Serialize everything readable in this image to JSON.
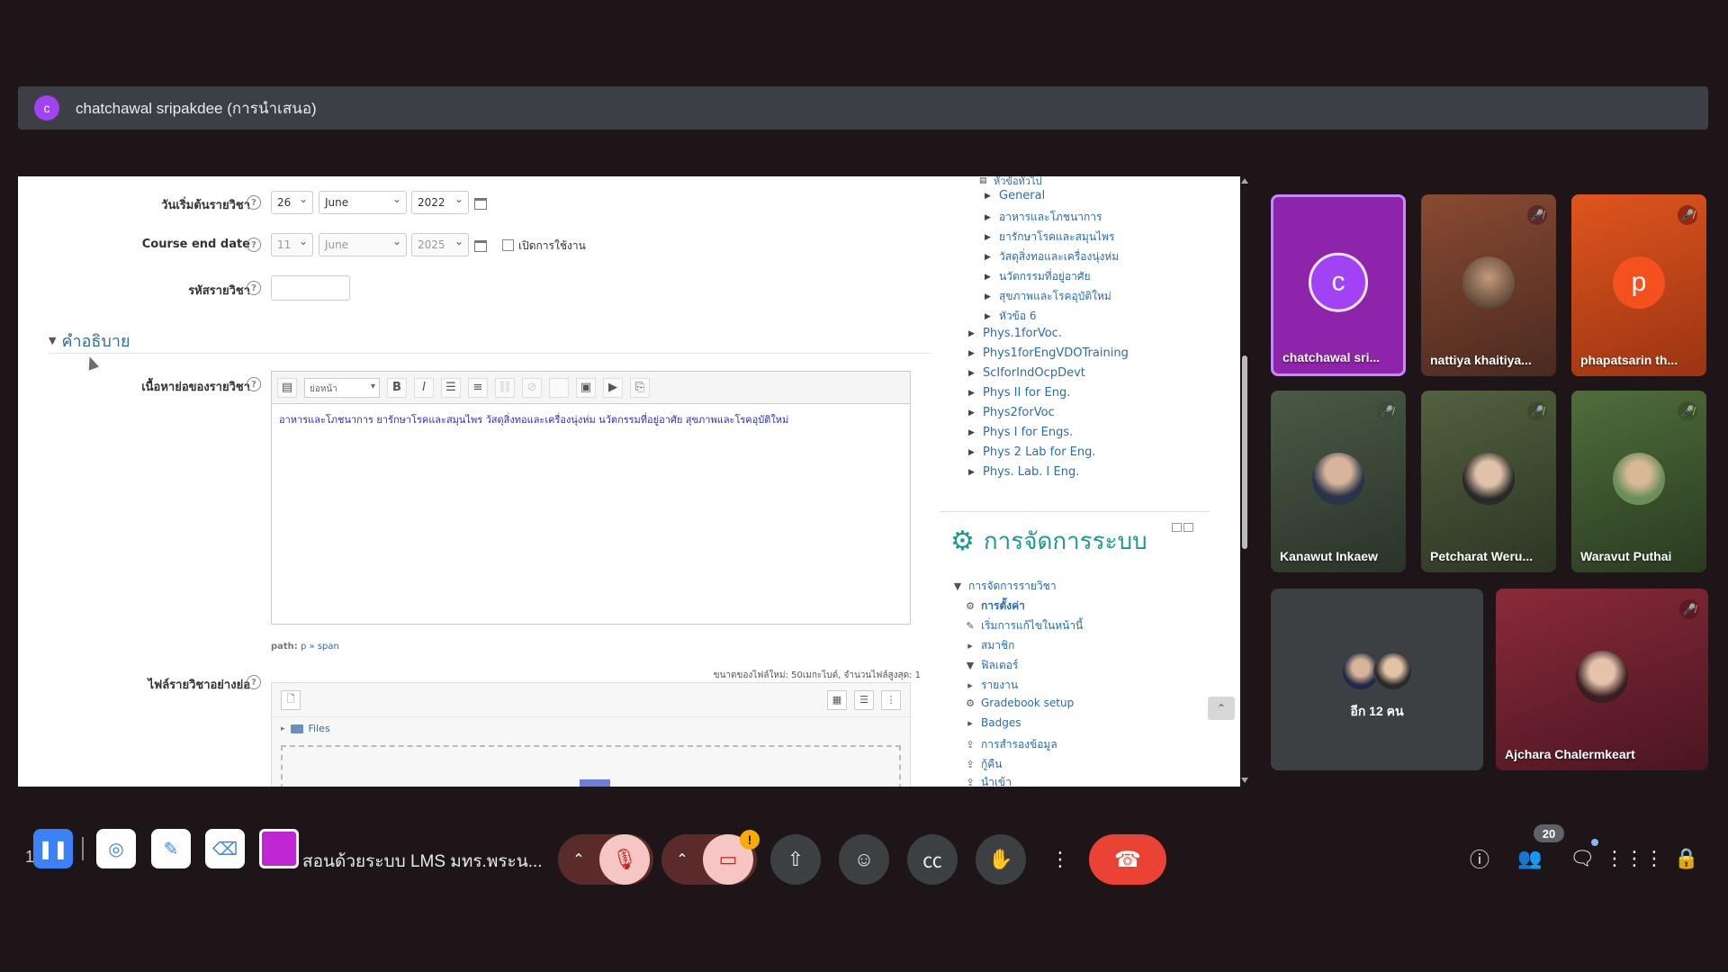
{
  "presenter": {
    "initial": "c",
    "name": "chatchawal sripakdee (การนำเสนอ)"
  },
  "form": {
    "start_date_label": "วันเริ่มต้นรายวิชา",
    "start_day": "26",
    "start_month": "June",
    "start_year": "2022",
    "end_date_label": "Course end date",
    "end_day": "11",
    "end_month": "June",
    "end_year": "2025",
    "enable_label": "เปิดการใช้งาน",
    "course_id_label": "รหัสรายวิชา",
    "section_title": "คำอธิบาย",
    "summary_label": "เนื้อหาย่อของรายวิชา",
    "editor_format": "ย่อหน้า",
    "editor_text": "อาหารและโภชนาการ ยารักษาโรคและสมุนไพร วัสดุสิ่งทอและเครื่องนุ่งห่ม นวัตกรรมที่อยู่อาศัย สุขภาพและโรคอุบัติใหม่",
    "editor_path_prefix": "path:",
    "editor_path": "p » span",
    "files_label": "ไฟล์รายวิชาอย่างย่อ",
    "file_size_note": "ขนาดของไฟล์ใหม่: 50เมกะไบต์, จำนวนไฟล์สูงสุด: 1",
    "files_folder": "Files"
  },
  "tree": {
    "items": [
      {
        "label": "หัวข้อทั่วไป"
      },
      {
        "label": "General"
      },
      {
        "label": "อาหารและโภชนาการ"
      },
      {
        "label": "ยารักษาโรคและสมุนไพร"
      },
      {
        "label": "วัสดุสิ่งทอและเครื่องนุ่งห่ม"
      },
      {
        "label": "นวัตกรรมที่อยู่อาศัย"
      },
      {
        "label": "สุขภาพและโรคอุบัติใหม่"
      },
      {
        "label": "หัวข้อ 6"
      },
      {
        "label": "Phys.1forVoc."
      },
      {
        "label": "Phys1forEngVDOTraining"
      },
      {
        "label": "ScIforIndOcpDevt"
      },
      {
        "label": "Phys II for Eng."
      },
      {
        "label": "Phys2forVoc"
      },
      {
        "label": "Phys I for Engs."
      },
      {
        "label": "Phys 2 Lab for Eng."
      },
      {
        "label": "Phys. Lab. I Eng."
      }
    ]
  },
  "admin": {
    "title": "การจัดการระบบ",
    "root": "การจัดการรายวิชา",
    "items": [
      {
        "label": "การตั้งค่า",
        "icon": "gear-icon"
      },
      {
        "label": "เริ่มการแก้ไขในหน้านี้",
        "icon": "pencil-icon"
      },
      {
        "label": "สมาชิก",
        "icon": "chevron-right-icon"
      },
      {
        "label": "ฟิลเตอร์",
        "icon": "filter-icon"
      },
      {
        "label": "รายงาน",
        "icon": "chevron-right-icon"
      },
      {
        "label": "Gradebook setup",
        "icon": "gear-icon"
      },
      {
        "label": "Badges",
        "icon": "chevron-right-icon"
      },
      {
        "label": "การสำรองข้อมูล",
        "icon": "upload-icon"
      },
      {
        "label": "กู้คืน",
        "icon": "upload-icon"
      },
      {
        "label": "นำเข้า",
        "icon": "upload-icon"
      }
    ]
  },
  "participants": [
    {
      "name": "chatchawal sri...",
      "initial": "c",
      "bg": "#8e24aa",
      "avatar": "#a142f4",
      "muted": false
    },
    {
      "name": "nattiya khaitiya...",
      "bg": "#6d3a2a",
      "muted": true
    },
    {
      "name": "phapatsarin th...",
      "initial": "p",
      "bg": "#c2410c",
      "avatar": "#f4511e",
      "muted": true
    },
    {
      "name": "Kanawut Inkaew",
      "bg": "#35473a",
      "muted": true
    },
    {
      "name": "Petcharat Weru...",
      "bg": "#3f4f35",
      "muted": true
    },
    {
      "name": "Waravut Puthai",
      "bg": "#3d5a34",
      "muted": true
    },
    {
      "name": "Ajchara Chalermkeart",
      "bg": "#6b1e2b",
      "muted": true
    }
  ],
  "overflow": {
    "label": "อีก 12 คน"
  },
  "toolbar": {
    "left_text": "1",
    "meeting_title": "สอนด้วยระบบ LMS มทร.พระน...",
    "people_count": "20",
    "colors": {
      "pen": "#c026d3",
      "hangup": "#ea4335",
      "warning": "#f9ab00"
    }
  }
}
